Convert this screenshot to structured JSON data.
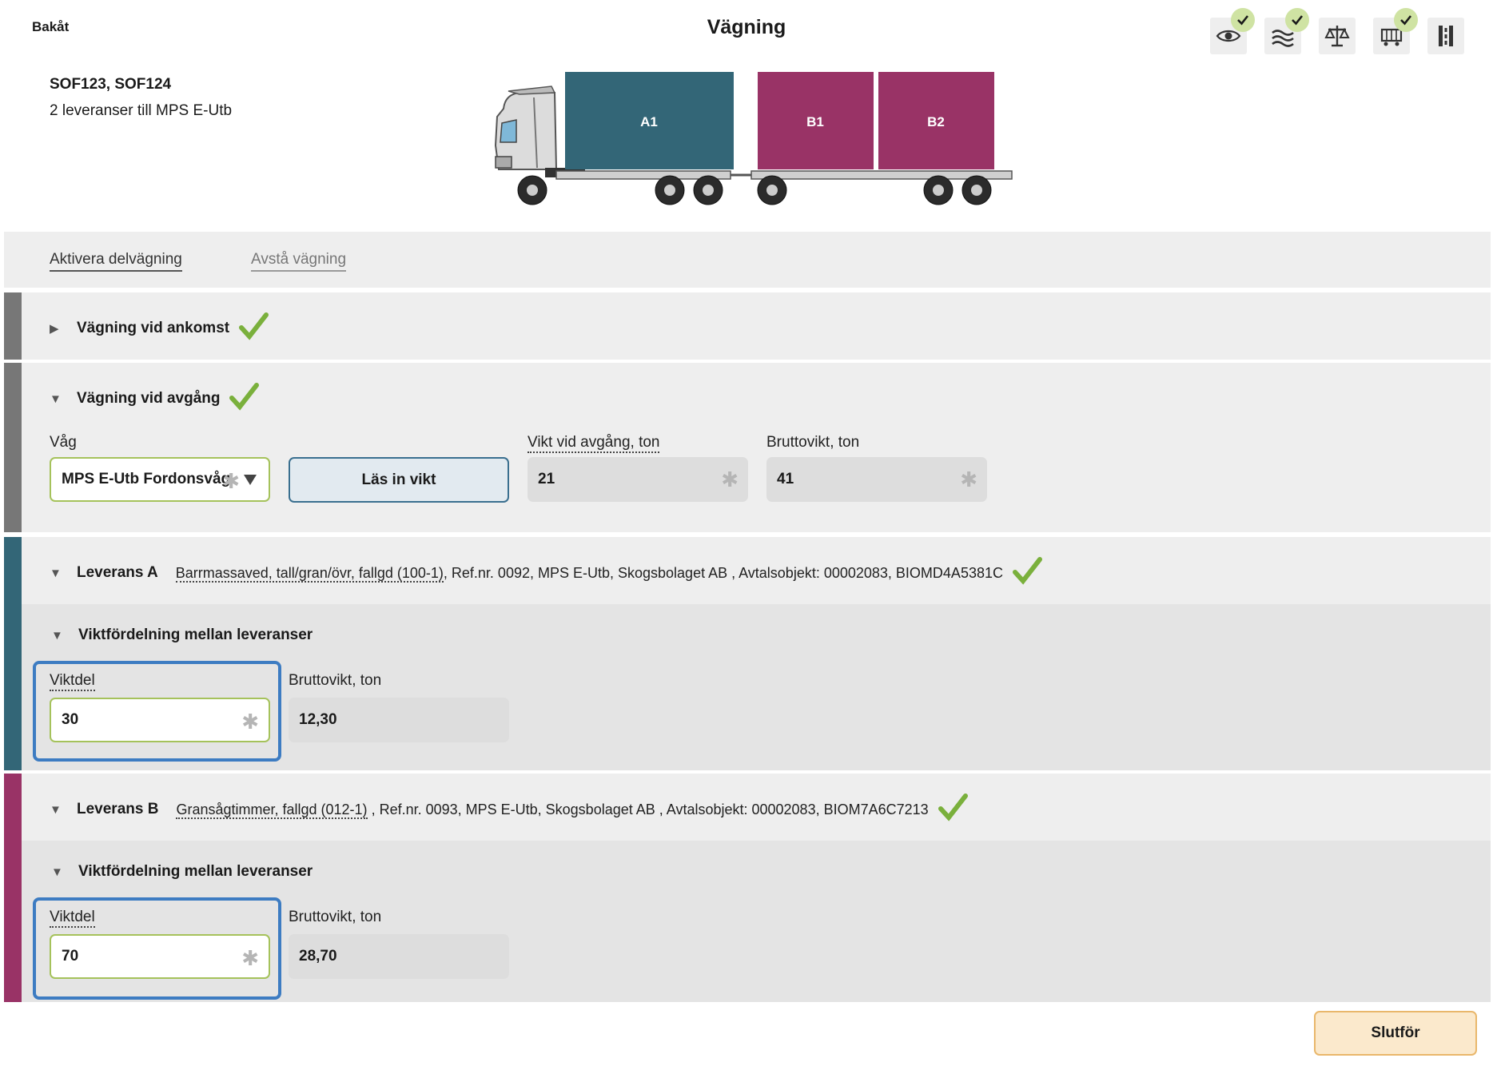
{
  "header": {
    "back_label": "Bakåt",
    "title": "Vägning"
  },
  "status_icons": [
    {
      "name": "eye-icon",
      "checked": true
    },
    {
      "name": "waves-icon",
      "checked": true
    },
    {
      "name": "scale-icon",
      "checked": false
    },
    {
      "name": "cart-icon",
      "checked": true
    },
    {
      "name": "road-icon",
      "checked": false
    }
  ],
  "vehicle": {
    "ids": "SOF123, SOF124",
    "description": "2 leveranser till MPS E-Utb",
    "compartments": [
      {
        "label": "A1",
        "color": "#336677"
      },
      {
        "label": "B1",
        "color": "#993366"
      },
      {
        "label": "B2",
        "color": "#993366"
      }
    ]
  },
  "actions": {
    "activate_partial": "Aktivera delvägning",
    "skip_weighing": "Avstå vägning"
  },
  "arrival": {
    "title": "Vägning vid ankomst",
    "completed": true
  },
  "departure": {
    "title": "Vägning vid avgång",
    "completed": true,
    "scale_label": "Våg",
    "scale_value": "MPS E-Utb Fordonsvåg",
    "read_button": "Läs in vikt",
    "weight_label": "Vikt vid avgång, ton",
    "weight_value": "21",
    "gross_label": "Bruttovikt, ton",
    "gross_value": "41"
  },
  "deliveries": [
    {
      "title": "Leverans A",
      "product": "Barrmassaved, tall/gran/övr, fallgd (100-1)",
      "details": ", Ref.nr. 0092, MPS E-Utb, Skogsbolaget AB , Avtalsobjekt: 00002083, BIOMD4A5381C",
      "color": "#336677",
      "completed": true,
      "distribution_title": "Viktfördelning mellan leveranser",
      "share_label": "Viktdel",
      "share_value": "30",
      "gross_label": "Bruttovikt, ton",
      "gross_value": "12,30"
    },
    {
      "title": "Leverans B",
      "product": "Gransågtimmer, fallgd (012-1)",
      "details": " , Ref.nr. 0093, MPS E-Utb, Skogsbolaget AB , Avtalsobjekt: 00002083, BIOM7A6C7213",
      "color": "#993366",
      "completed": true,
      "distribution_title": "Viktfördelning mellan leveranser",
      "share_label": "Viktdel",
      "share_value": "70",
      "gross_label": "Bruttovikt, ton",
      "gross_value": "28,70"
    }
  ],
  "footer": {
    "finish_label": "Slutför"
  },
  "colors": {
    "check_green": "#7ab03c",
    "neutral_stripe": "#777777",
    "focus_blue": "#3d7cc2",
    "finish_bg": "#fbe9cc"
  }
}
